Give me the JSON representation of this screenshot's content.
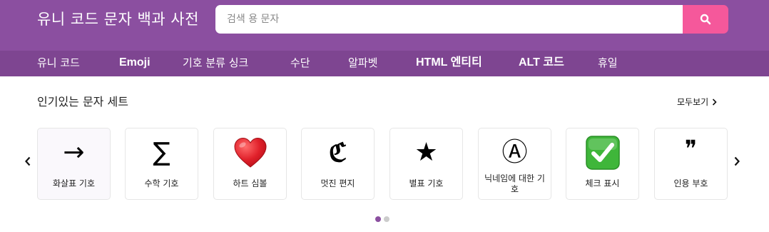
{
  "header": {
    "site_title": "유니 코드 문자 백과 사전",
    "search_placeholder": "검색 용 문자",
    "search_icon": "search-icon"
  },
  "nav": {
    "items": [
      {
        "label": "유니 코드"
      },
      {
        "label": "Emoji"
      },
      {
        "label": "기호 분류 싱크"
      },
      {
        "label": "수단"
      },
      {
        "label": "알파벳"
      },
      {
        "label": "HTML 엔티티"
      },
      {
        "label": "ALT 코드"
      },
      {
        "label": "휴일"
      }
    ]
  },
  "popular": {
    "title": "인기있는 문자 세트",
    "see_all": "모두보기",
    "cards": [
      {
        "symbol": "→",
        "label": "화살표 기호"
      },
      {
        "symbol": "∑",
        "label": "수학 기호"
      },
      {
        "symbol": "heart-emoji",
        "label": "하트 심볼"
      },
      {
        "symbol": "ℭ",
        "label": "멋진 편지"
      },
      {
        "symbol": "★",
        "label": "별표 기호"
      },
      {
        "symbol": "Ⓐ",
        "label": "닉네임에 대한 기호"
      },
      {
        "symbol": "check-mark-emoji",
        "label": "체크 표시"
      },
      {
        "symbol": "❞",
        "label": "인용 부호"
      }
    ],
    "carousel_pages": 2,
    "active_page": 1
  },
  "colors": {
    "header_bg": "#8b4fa0",
    "nav_bg": "#7e4591",
    "search_button": "#f5589b",
    "active_dot": "#8b4fa0"
  }
}
